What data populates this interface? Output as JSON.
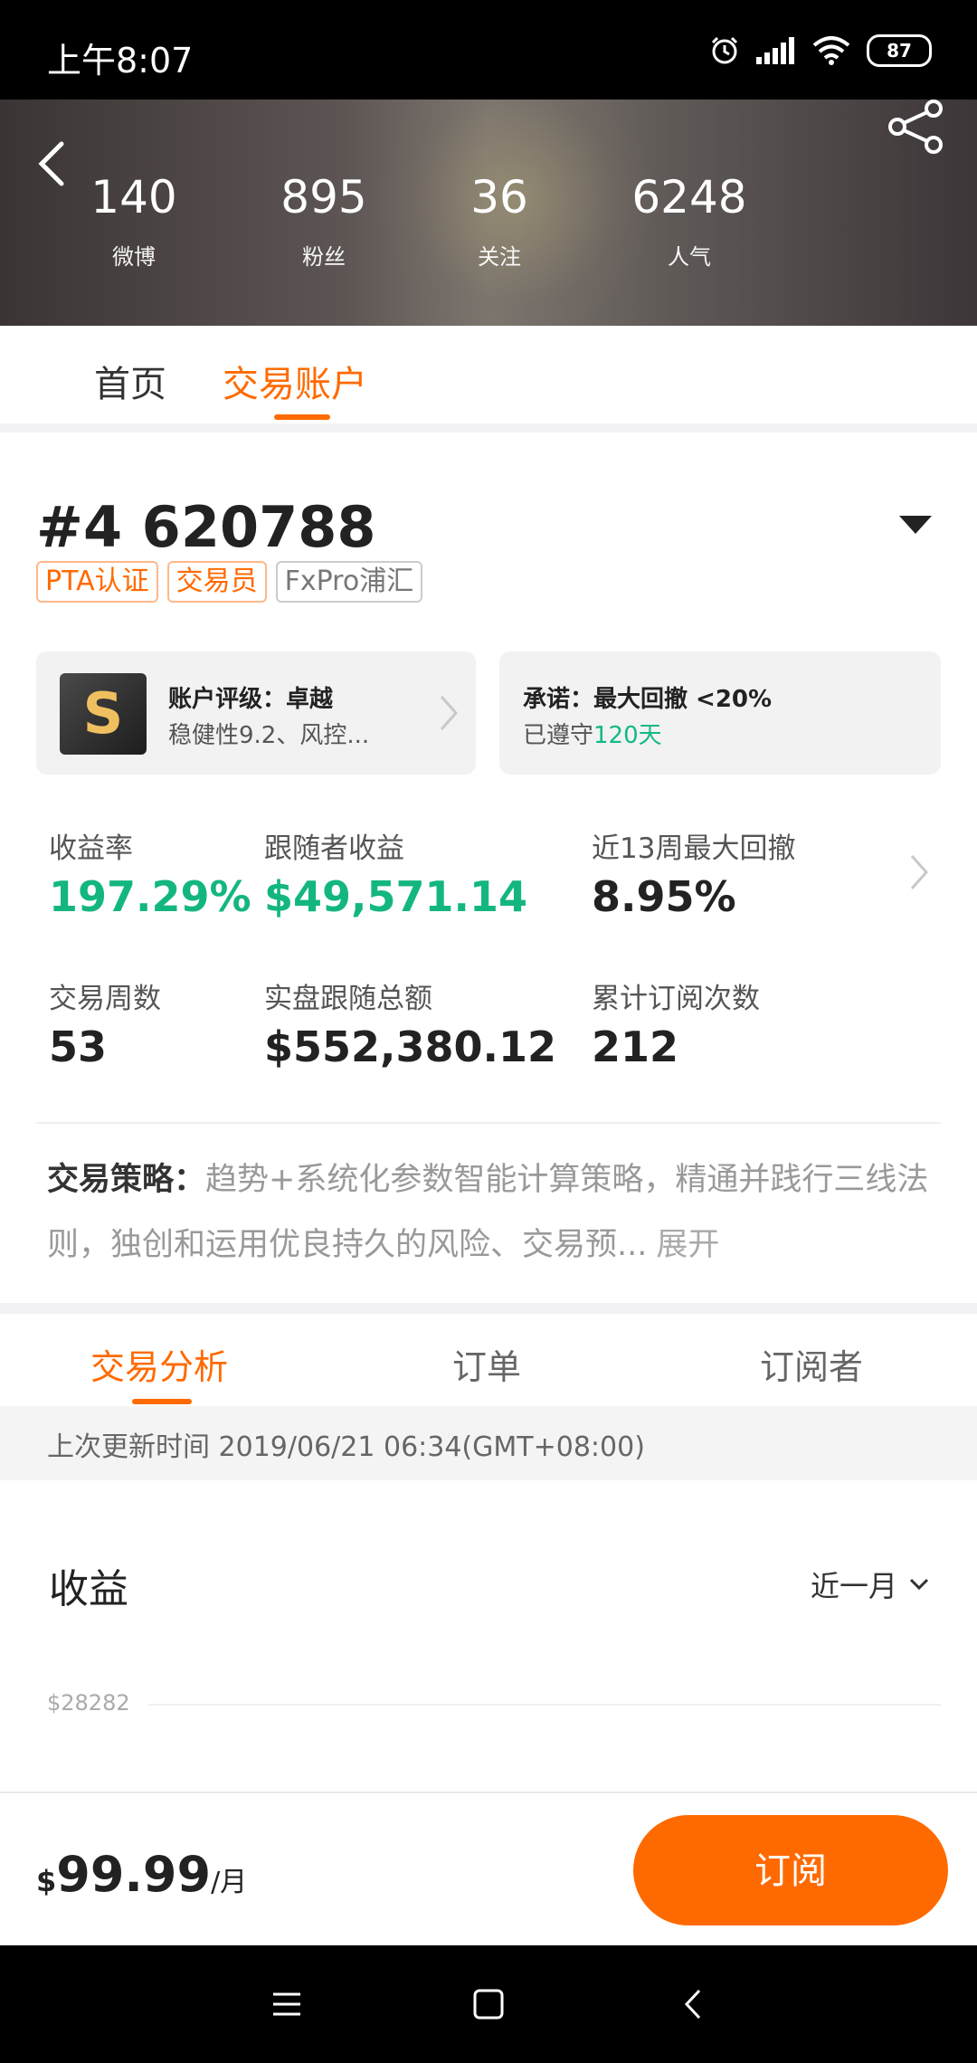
{
  "status_bar": {
    "time": "上午8:07",
    "battery": "87"
  },
  "header": {
    "stats": [
      {
        "value": "140",
        "label": "微博"
      },
      {
        "value": "895",
        "label": "粉丝"
      },
      {
        "value": "36",
        "label": "关注"
      },
      {
        "value": "6248",
        "label": "人气"
      }
    ]
  },
  "tabs_top": {
    "home": "首页",
    "trading_account": "交易账户"
  },
  "account": {
    "id": "#4 620788",
    "tags": [
      "PTA认证",
      "交易员",
      "FxPro浦汇"
    ],
    "rating": {
      "badge": "S",
      "title": "账户评级：卓越",
      "subtitle": "稳健性9.2、风控..."
    },
    "promise": {
      "title": "承诺：最大回撤 <20%",
      "prefix": "已遵守",
      "days": "120天"
    },
    "metrics": {
      "return_rate": {
        "label": "收益率",
        "value": "197.29%"
      },
      "follower_profit": {
        "label": "跟随者收益",
        "value": "$49,571.14"
      },
      "max_drawdown": {
        "label": "近13周最大回撤",
        "value": "8.95%"
      },
      "trading_weeks": {
        "label": "交易周数",
        "value": "53"
      },
      "follow_total": {
        "label": "实盘跟随总额",
        "value": "$552,380.12"
      },
      "subscription_count": {
        "label": "累计订阅次数",
        "value": "212"
      }
    },
    "strategy": {
      "label": "交易策略：",
      "text": "趋势+系统化参数智能计算策略，精通并践行三线法则，独创和运用优良持久的风险、交易预...",
      "expand": "展开"
    }
  },
  "tabs_analysis": {
    "analysis": "交易分析",
    "orders": "订单",
    "subscribers": "订阅者"
  },
  "update": {
    "text": "上次更新时间 2019/06/21 06:34(GMT+08:00)"
  },
  "chart": {
    "title": "收益",
    "range": "近一月",
    "y_tick": "$28282"
  },
  "bottom": {
    "currency": "$",
    "price": "99.99",
    "unit": "/月",
    "subscribe": "订阅"
  },
  "colors": {
    "accent": "#ff6a00",
    "positive": "#14b67f"
  }
}
